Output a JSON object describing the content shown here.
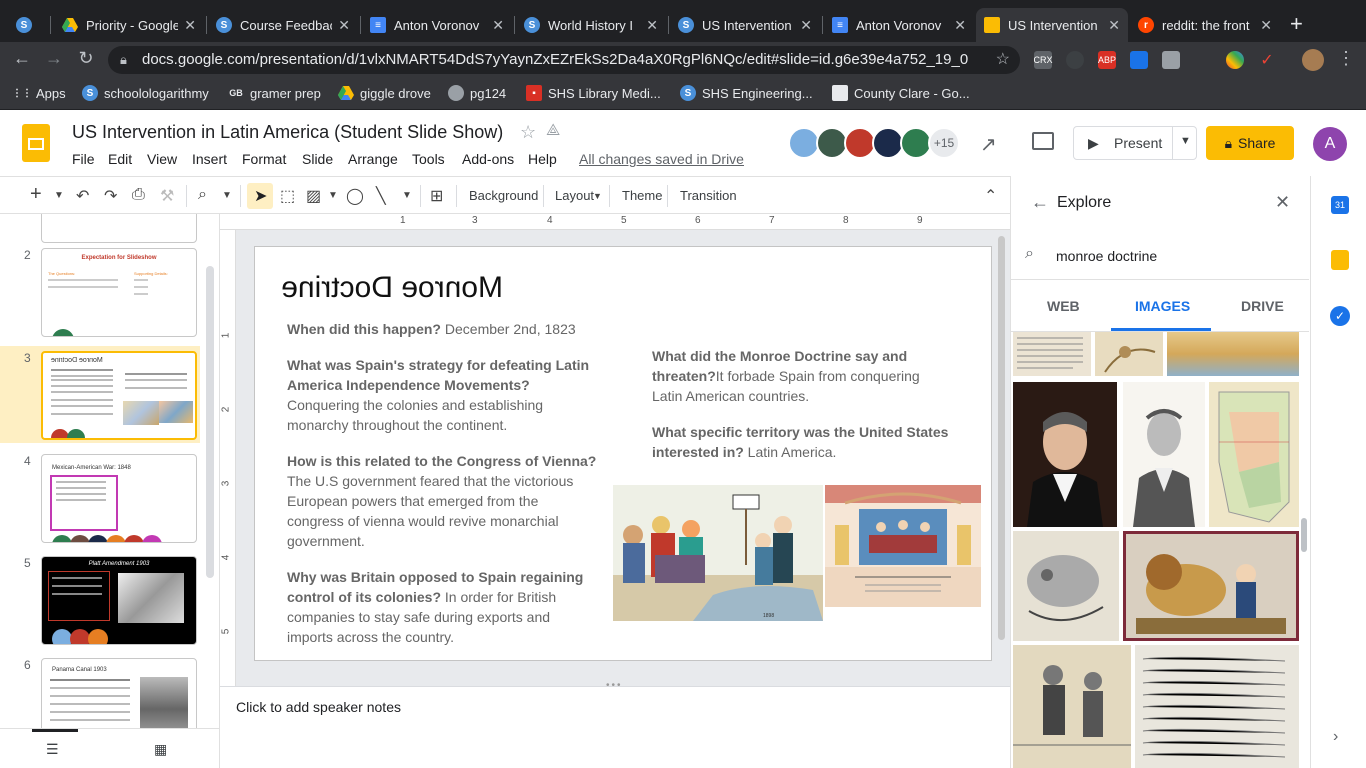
{
  "browser": {
    "tabs": [
      {
        "title": "",
        "icon": "s-icon",
        "color": "#4a90d9"
      },
      {
        "title": "Priority - Google",
        "icon": "drive-icon",
        "color": "#34a853"
      },
      {
        "title": "Course Feedbac",
        "icon": "s-icon",
        "color": "#4a90d9"
      },
      {
        "title": "Anton Voronov",
        "icon": "docs-icon",
        "color": "#4285f4"
      },
      {
        "title": "World History I",
        "icon": "s-icon",
        "color": "#4a90d9"
      },
      {
        "title": "US Intervention",
        "icon": "s-icon",
        "color": "#4a90d9"
      },
      {
        "title": "Anton Voronov",
        "icon": "docs-icon",
        "color": "#4285f4"
      },
      {
        "title": "US Intervention",
        "icon": "slides-icon",
        "color": "#fbbc04"
      },
      {
        "title": "reddit: the front",
        "icon": "reddit-icon",
        "color": "#ff4500"
      }
    ],
    "new_tab": "+",
    "url": "docs.google.com/presentation/d/1vlxNMART54DdS7yYaynZxEZrEkSs2Da4aX0RgPl6NQc/edit#slide=id.g6e39e4a752_19_0",
    "bookmarks": [
      {
        "label": "Apps",
        "icon": "apps-icon"
      },
      {
        "label": "schoolologarithmy",
        "icon": "s-icon"
      },
      {
        "label": "gramer prep",
        "icon": "gb-icon"
      },
      {
        "label": "giggle drove",
        "icon": "drive-icon"
      },
      {
        "label": "pg124",
        "icon": "globe-icon"
      },
      {
        "label": "SHS Library Medi...",
        "icon": "bookmark-icon"
      },
      {
        "label": "SHS Engineering...",
        "icon": "s-icon"
      },
      {
        "label": "County Clare - Go...",
        "icon": "bookmark-icon"
      }
    ],
    "extensions": [
      "CRX",
      "",
      "ABP",
      "",
      "",
      "",
      ""
    ]
  },
  "header": {
    "title": "US Intervention in Latin America (Student Slide Show)",
    "menus": [
      "File",
      "Edit",
      "View",
      "Insert",
      "Format",
      "Slide",
      "Arrange",
      "Tools",
      "Add-ons",
      "Help"
    ],
    "saved_status": "All changes saved in Drive",
    "collaborator_count": "+15",
    "present_label": "Present",
    "share_label": "Share",
    "account_initial": "A"
  },
  "toolbar": {
    "background": "Background",
    "layout": "Layout",
    "theme": "Theme",
    "transition": "Transition"
  },
  "ruler": {
    "top_ticks": [
      "1",
      "2",
      "3",
      "4",
      "5",
      "6",
      "7",
      "8",
      "9"
    ],
    "left_ticks": [
      "1",
      "2",
      "3",
      "4",
      "5"
    ]
  },
  "filmstrip": {
    "slides": [
      {
        "number": "2",
        "title": "Expectation for Slideshow",
        "col1": "The Questions:",
        "col2": "Supporting Details:"
      },
      {
        "number": "3",
        "title": "Monroe Doctrine"
      },
      {
        "number": "4",
        "title": "Mexican-American War: 1848"
      },
      {
        "number": "5",
        "title": "Platt Amendment 1903"
      },
      {
        "number": "6",
        "title": "Panama Canal 1903"
      }
    ]
  },
  "slide": {
    "title": "Monroe Doctrine",
    "left": [
      {
        "q": "When did this happen?",
        "a": " December 2nd, 1823"
      },
      {
        "q": "What was Spain's strategy for defeating Latin America Independence Movements?",
        "a": "Conquering the colonies and establishing monarchy throughout the continent."
      },
      {
        "q": "How is this related to the Congress of Vienna?",
        "a": " The U.S government feared that the victorious European powers that emerged from the congress of vienna would revive monarchial government."
      },
      {
        "q": "Why was Britain opposed to Spain regaining control of its colonies?",
        "a": " In order for British companies to stay safe during exports and imports across the country."
      }
    ],
    "right": [
      {
        "q": "What did the Monroe Doctrine say and threaten?",
        "a": "It forbade Spain from conquering Latin American countries."
      },
      {
        "q": "What specific territory was the United States interested in?",
        "a": " Latin America."
      }
    ]
  },
  "notes": {
    "placeholder": "Click to add speaker notes"
  },
  "explore": {
    "title": "Explore",
    "query": "monroe doctrine",
    "tabs": [
      "WEB",
      "IMAGES",
      "DRIVE"
    ],
    "active_tab": "IMAGES"
  },
  "colors": {
    "accent": "#1a73e8",
    "slides_yellow": "#fbbc04",
    "selected_thumb": "#feefc3"
  }
}
